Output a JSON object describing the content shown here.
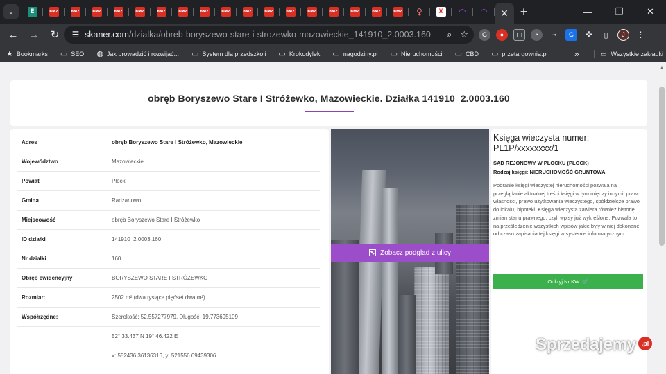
{
  "browser": {
    "tab_favicon_label": "BMZ",
    "url_domain": "skaner.com",
    "url_path": "/dzialka/obreb-boryszewo-stare-i-strozewko-mazowieckie_141910_2.0003.160",
    "profile_initial": "J",
    "bookmarks": [
      {
        "label": "Bookmarks",
        "icon": "star-icon"
      },
      {
        "label": "SEO",
        "icon": "folder-icon"
      },
      {
        "label": "Jak prowadzić i rozwijać...",
        "icon": "globe-icon"
      },
      {
        "label": "System dla przedszkoli",
        "icon": "folder-icon"
      },
      {
        "label": "Krokodylek",
        "icon": "folder-icon"
      },
      {
        "label": "nagodziny.pl",
        "icon": "folder-icon"
      },
      {
        "label": "Nieruchomości",
        "icon": "folder-icon"
      },
      {
        "label": "CBD",
        "icon": "folder-icon"
      },
      {
        "label": "przetargownia.pl",
        "icon": "folder-icon"
      }
    ],
    "more_bookmarks": "»",
    "all_bookmarks": "Wszystkie zakładki"
  },
  "page": {
    "title": "obręb Boryszewo Stare I Stróżewko, Mazowieckie. Działka 141910_2.0003.160",
    "details": [
      {
        "key": "Adres",
        "value": "obręb Boryszewo Stare I Stróżewko, Mazowieckie"
      },
      {
        "key": "Województwo",
        "value": "Mazowieckie"
      },
      {
        "key": "Powiat",
        "value": "Płocki"
      },
      {
        "key": "Gmina",
        "value": "Radzanowo"
      },
      {
        "key": "Miejscowość",
        "value": "obręb Boryszewo Stare I Stróżewko"
      },
      {
        "key": "ID działki",
        "value": "141910_2.0003.160"
      },
      {
        "key": "Nr działki",
        "value": "160"
      },
      {
        "key": "Obręb ewidencyjny",
        "value": "BORYSZEWO STARE I STRÓŻEWKO"
      },
      {
        "key": "Rozmiar:",
        "value": "2502 m² (dwa tysiące pięćset dwa m²)"
      },
      {
        "key": "Współrzędne:",
        "value": "Szerokość: 52.557277979, Długość: 19.773695109"
      },
      {
        "key": "",
        "value": "52° 33.437 N 19° 46.422 E"
      },
      {
        "key": "",
        "value": "x: 552436.36136316, y: 521556.69439306"
      }
    ],
    "street_view_label": "Zobacz podgląd z ulicy",
    "land_registry": {
      "heading": "Księga wieczysta numer: PL1P/xxxxxxxx/1",
      "court": "SĄD REJONOWY W PŁOCKU (PŁOCK)",
      "type_label": "Rodzaj księgi:",
      "type_value": "NIERUCHOMOŚĆ GRUNTOWA",
      "description": "Pobranie księgi wieczystej nieruchomości pozwala na przeglądanie aktualnej treści księgi w tym między innymi: prawo własności, prawo użytkowania wieczystego, spółdzielcze prawo do lokalu, hipoteki. Księga wieczysta zawiera również historię zmian stanu prawnego, czyli wpisy już wykreślone. Pozwala to na prześledzenie wszystkich wpisów jakie były w niej dokonane od czasu zapisania tej księgi w systemie informatycznym.",
      "button_label": "Odkryj Nr KW"
    }
  },
  "watermark": {
    "text": "Sprzedajemy",
    "badge": ".pl"
  },
  "colors": {
    "accent": "#9b4dca",
    "button_green": "#3cb04c",
    "badge_red": "#d93025"
  }
}
